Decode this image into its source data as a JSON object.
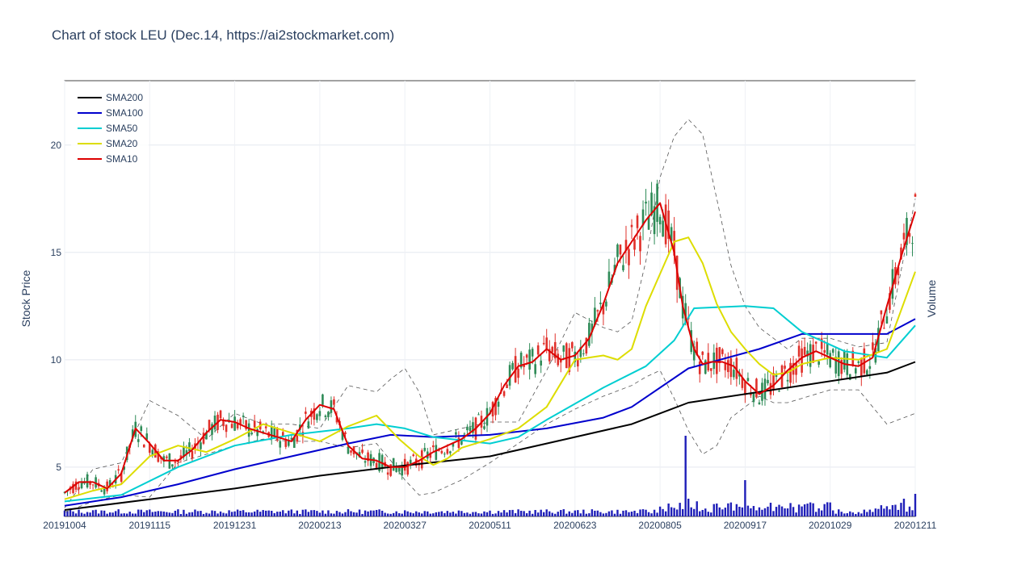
{
  "chart_data": {
    "type": "line",
    "title": "Chart of stock LEU (Dec.14, https://ai2stockmarket.com)",
    "ylabel": "Stock Price",
    "y2label": "Volume",
    "ylim": [
      2.7,
      23.0
    ],
    "y_ticks": [
      5,
      10,
      15,
      20
    ],
    "x_tick_labels": [
      "20191004",
      "20191115",
      "20191231",
      "20200213",
      "20200327",
      "20200511",
      "20200623",
      "20200805",
      "20200917",
      "20201029",
      "20201211"
    ],
    "x_range": [
      0,
      300
    ],
    "x_tick_positions": [
      0,
      30,
      60,
      90,
      120,
      150,
      180,
      210,
      240,
      270,
      300
    ],
    "grid": true,
    "legend_position": "top-left",
    "series": [
      {
        "name": "SMA200",
        "color": "#000000",
        "x": [
          0,
          30,
          60,
          90,
          115,
          150,
          170,
          200,
          220,
          260,
          290,
          300
        ],
        "values": [
          3.0,
          3.5,
          4.0,
          4.6,
          5.0,
          5.5,
          6.1,
          7.0,
          8.0,
          8.8,
          9.4,
          9.9
        ]
      },
      {
        "name": "SMA100",
        "color": "#0000cd",
        "x": [
          0,
          20,
          40,
          60,
          80,
          100,
          115,
          130,
          150,
          170,
          190,
          200,
          220,
          245,
          260,
          290,
          300
        ],
        "values": [
          3.2,
          3.6,
          4.2,
          4.9,
          5.5,
          6.1,
          6.5,
          6.4,
          6.5,
          6.8,
          7.3,
          7.8,
          9.6,
          10.5,
          11.2,
          11.2,
          11.9
        ]
      },
      {
        "name": "SMA50",
        "color": "#00ced1",
        "x": [
          0,
          20,
          40,
          60,
          80,
          100,
          110,
          120,
          130,
          150,
          160,
          170,
          190,
          205,
          215,
          222,
          240,
          250,
          260,
          275,
          290,
          300
        ],
        "values": [
          3.4,
          3.7,
          5.0,
          6.0,
          6.5,
          6.8,
          7.0,
          6.8,
          6.4,
          6.1,
          6.4,
          7.2,
          8.7,
          9.7,
          10.9,
          12.4,
          12.5,
          12.4,
          11.3,
          10.4,
          10.1,
          11.6
        ]
      },
      {
        "name": "SMA20",
        "color": "#dddd00",
        "x": [
          0,
          10,
          20,
          30,
          40,
          50,
          60,
          70,
          80,
          90,
          100,
          110,
          118,
          125,
          130,
          135,
          140,
          150,
          160,
          170,
          180,
          190,
          195,
          200,
          205,
          210,
          215,
          220,
          225,
          230,
          235,
          240,
          245,
          250,
          255,
          260,
          270,
          280,
          290,
          300
        ],
        "values": [
          3.5,
          3.9,
          4.2,
          5.5,
          6.0,
          5.7,
          6.3,
          7.0,
          6.6,
          6.2,
          6.9,
          7.4,
          6.3,
          5.5,
          5.1,
          5.4,
          5.9,
          6.3,
          6.8,
          7.8,
          10.0,
          10.2,
          10.0,
          10.5,
          12.5,
          14.0,
          15.5,
          15.7,
          14.5,
          12.6,
          11.3,
          10.5,
          9.8,
          9.3,
          9.4,
          9.8,
          10.1,
          10.0,
          10.5,
          14.1
        ]
      },
      {
        "name": "SMA10",
        "color": "#dd0000",
        "x": [
          0,
          5,
          10,
          15,
          20,
          25,
          30,
          35,
          40,
          45,
          50,
          55,
          60,
          65,
          70,
          75,
          80,
          85,
          90,
          95,
          100,
          105,
          110,
          115,
          120,
          125,
          130,
          135,
          140,
          145,
          150,
          155,
          160,
          165,
          170,
          175,
          180,
          185,
          190,
          195,
          200,
          205,
          210,
          215,
          218,
          222,
          225,
          228,
          232,
          236,
          240,
          245,
          250,
          255,
          260,
          265,
          270,
          275,
          280,
          285,
          290,
          295,
          300
        ],
        "values": [
          3.8,
          4.3,
          4.3,
          4.0,
          4.7,
          6.8,
          6.1,
          5.3,
          5.3,
          5.8,
          6.6,
          7.2,
          7.1,
          6.8,
          6.6,
          6.4,
          6.2,
          7.2,
          7.9,
          7.7,
          6.0,
          5.4,
          5.3,
          5.0,
          5.0,
          5.3,
          5.7,
          6.0,
          6.3,
          6.8,
          7.5,
          8.8,
          9.7,
          9.9,
          10.5,
          10.0,
          10.2,
          11.0,
          12.6,
          14.5,
          15.5,
          16.5,
          17.3,
          15.0,
          12.5,
          10.5,
          9.8,
          9.9,
          9.9,
          9.7,
          9.0,
          8.4,
          8.8,
          9.5,
          10.1,
          10.4,
          10.1,
          9.8,
          9.7,
          10.1,
          12.5,
          14.8,
          16.9
        ]
      }
    ],
    "upper_band_x": [
      0,
      10,
      20,
      30,
      40,
      50,
      60,
      70,
      80,
      90,
      100,
      110,
      115,
      120,
      125,
      130,
      140,
      150,
      160,
      170,
      180,
      190,
      195,
      200,
      205,
      210,
      215,
      220,
      225,
      230,
      235,
      240,
      245,
      250,
      255,
      260,
      270,
      280,
      290,
      300
    ],
    "upper_band": [
      3.1,
      4.9,
      5.2,
      8.1,
      7.4,
      6.3,
      7.5,
      7.0,
      7.0,
      6.8,
      8.8,
      8.5,
      9.1,
      9.6,
      8.5,
      6.5,
      6.8,
      7.1,
      7.1,
      9.5,
      12.2,
      11.5,
      11.3,
      11.8,
      14.6,
      18.5,
      20.4,
      21.2,
      20.5,
      17.5,
      14.4,
      12.5,
      11.5,
      11.0,
      10.5,
      11.0,
      11.0,
      10.6,
      10.8,
      17.5
    ],
    "lower_band_x": [
      0,
      10,
      20,
      30,
      40,
      50,
      60,
      70,
      80,
      90,
      100,
      110,
      115,
      120,
      125,
      130,
      140,
      150,
      160,
      170,
      180,
      190,
      200,
      205,
      210,
      215,
      220,
      225,
      230,
      235,
      240,
      245,
      250,
      255,
      260,
      270,
      280,
      290,
      300
    ],
    "lower_band": [
      2.9,
      3.4,
      3.7,
      3.6,
      5.2,
      5.6,
      6.0,
      6.3,
      6.2,
      6.2,
      5.9,
      6.1,
      5.3,
      4.4,
      3.7,
      3.8,
      4.4,
      5.2,
      6.1,
      7.0,
      7.7,
      8.3,
      8.8,
      9.2,
      9.5,
      8.2,
      6.7,
      5.6,
      6.0,
      7.3,
      7.8,
      8.3,
      8.0,
      8.0,
      8.2,
      8.6,
      8.6,
      7.0,
      7.5
    ]
  }
}
